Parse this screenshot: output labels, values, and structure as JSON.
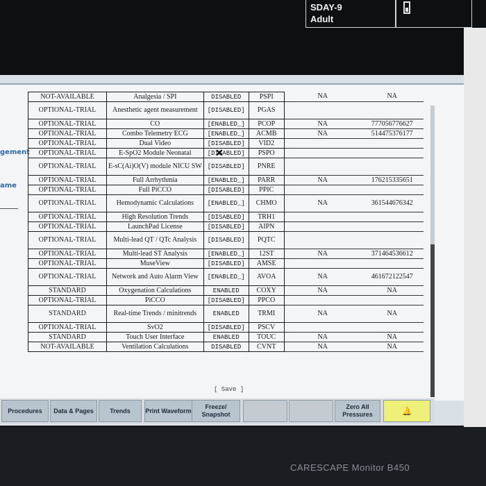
{
  "patient": {
    "line1": "SDAY-9",
    "line2": "Adult"
  },
  "left_labels": [
    "gement",
    "ame"
  ],
  "cursor": "✕",
  "table": {
    "rows": [
      {
        "status": "NOT-AVAILABLE",
        "feature": "Analgesia / SPI",
        "state": "DISABLED",
        "code": "PSPI",
        "col5": "NA",
        "col6": "NA"
      },
      {
        "status": "OPTIONAL-TRIAL",
        "feature": "Anesthetic agent measurement",
        "state": "[DISABLED]",
        "code": "PGAS",
        "col5": "",
        "col6": "",
        "tall": true
      },
      {
        "status": "OPTIONAL-TRIAL",
        "feature": "CO",
        "state": "[ENABLED_]",
        "code": "PCOP",
        "col5": "NA",
        "col6": "777056776627"
      },
      {
        "status": "OPTIONAL-TRIAL",
        "feature": "Combo Telemetry ECG",
        "state": "[ENABLED_]",
        "code": "ACMB",
        "col5": "NA",
        "col6": "514475376177"
      },
      {
        "status": "OPTIONAL-TRIAL",
        "feature": "Dual Video",
        "state": "[DISABLED]",
        "code": "VID2",
        "col5": "",
        "col6": ""
      },
      {
        "status": "OPTIONAL-TRIAL",
        "feature": "E-SpO2 Module Neonatal",
        "state": "[DISABLED]",
        "code": "PSPO",
        "col5": "",
        "col6": ""
      },
      {
        "status": "OPTIONAL-TRIAL",
        "feature": "E-sC(Ai)O(V) module NICU SW",
        "state": "[DISABLED]",
        "code": "PNRE",
        "col5": "",
        "col6": "",
        "tall": true
      },
      {
        "status": "OPTIONAL-TRIAL",
        "feature": "Full Arrhythmia",
        "state": "[ENABLED_]",
        "code": "PARR",
        "col5": "NA",
        "col6": "176215335651"
      },
      {
        "status": "OPTIONAL-TRIAL",
        "feature": "Full PiCCO",
        "state": "[DISABLED]",
        "code": "PPIC",
        "col5": "",
        "col6": ""
      },
      {
        "status": "OPTIONAL-TRIAL",
        "feature": "Hemodynamic Calculations",
        "state": "[ENABLED_]",
        "code": "CHMO",
        "col5": "NA",
        "col6": "361544676342",
        "tall": true
      },
      {
        "status": "OPTIONAL-TRIAL",
        "feature": "High Resolution Trends",
        "state": "[DISABLED]",
        "code": "TRH1",
        "col5": "",
        "col6": ""
      },
      {
        "status": "OPTIONAL-TRIAL",
        "feature": "LaunchPad License",
        "state": "[DISABLED]",
        "code": "AIPN",
        "col5": "",
        "col6": ""
      },
      {
        "status": "OPTIONAL-TRIAL",
        "feature": "Multi-lead QT / QTc Analysis",
        "state": "[DISABLED]",
        "code": "PQTC",
        "col5": "",
        "col6": "",
        "tall": true
      },
      {
        "status": "OPTIONAL-TRIAL",
        "feature": "Multi-lead ST Analysis",
        "state": "[ENABLED_]",
        "code": "12ST",
        "col5": "NA",
        "col6": "371464536612"
      },
      {
        "status": "OPTIONAL-TRIAL",
        "feature": "MuseView",
        "state": "[DISABLED]",
        "code": "AMSE",
        "col5": "",
        "col6": ""
      },
      {
        "status": "OPTIONAL-TRIAL",
        "feature": "Network and Auto Alarm View",
        "state": "[ENABLED_]",
        "code": "AVOA",
        "col5": "NA",
        "col6": "461672122547",
        "tall": true
      },
      {
        "status": "STANDARD",
        "feature": "Oxygenation Calculations",
        "state": "ENABLED",
        "code": "COXY",
        "col5": "NA",
        "col6": "NA"
      },
      {
        "status": "OPTIONAL-TRIAL",
        "feature": "PiCCO",
        "state": "[DISABLED]",
        "code": "PPCO",
        "col5": "",
        "col6": ""
      },
      {
        "status": "STANDARD",
        "feature": "Real-time Trends / minitrends",
        "state": "ENABLED",
        "code": "TRMI",
        "col5": "NA",
        "col6": "NA",
        "tall": true
      },
      {
        "status": "OPTIONAL-TRIAL",
        "feature": "SvO2",
        "state": "[DISABLED]",
        "code": "PSCV",
        "col5": "",
        "col6": ""
      },
      {
        "status": "STANDARD",
        "feature": "Touch User Interface",
        "state": "ENABLED",
        "code": "TOUC",
        "col5": "NA",
        "col6": "NA"
      },
      {
        "status": "NOT-AVAILABLE",
        "feature": "Ventilation Calculations",
        "state": "DISABLED",
        "code": "CVNT",
        "col5": "NA",
        "col6": "NA"
      }
    ]
  },
  "save_label": "[ Save ]",
  "toolbar": {
    "buttons": [
      {
        "label": "Procedures",
        "disabled": false
      },
      {
        "label": "Data & Pages",
        "disabled": false
      },
      {
        "label": "Trends",
        "disabled": false
      },
      {
        "label": "Print Waveforms",
        "disabled": false
      },
      {
        "label": "Freeze/ Snapshot",
        "disabled": false
      },
      {
        "label": "",
        "disabled": true
      },
      {
        "label": "",
        "disabled": true
      },
      {
        "label": "Zero All Pressures",
        "disabled": false
      },
      {
        "label": "",
        "alarm": true
      }
    ]
  },
  "brand": "CARESCAPE Monitor B450",
  "colors": {
    "accent": "#2e6aa8",
    "alarm": "#eef07a",
    "toolbar": "#b9c5ce"
  }
}
